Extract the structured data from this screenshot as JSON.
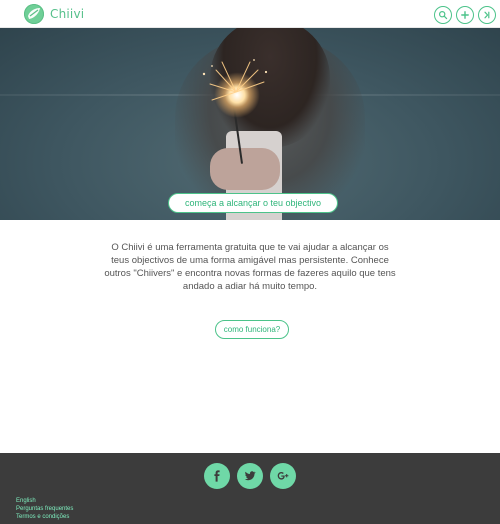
{
  "header": {
    "brand_text": "Chiivi",
    "icons": [
      "search-icon",
      "plus-icon",
      "login-icon"
    ]
  },
  "hero": {
    "cta_text": "começa a alcançar o teu objectivo"
  },
  "main": {
    "description": "O Chiivi é uma ferramenta gratuita que te vai ajudar a alcançar os teus objectivos de uma forma amigável mas persistente. Conhece outros \"Chiivers\" e encontra novas formas de fazeres aquilo que tens andado a adiar há muito tempo.",
    "how_button": "como funciona?"
  },
  "footer": {
    "social": [
      "facebook-icon",
      "twitter-icon",
      "google-plus-icon"
    ],
    "links": [
      "English",
      "Perguntas frequentes",
      "Termos e condições"
    ]
  },
  "colors": {
    "accent": "#4cc38a",
    "footer_bg": "#3c3c3c",
    "footer_link": "#7ff0c0"
  }
}
